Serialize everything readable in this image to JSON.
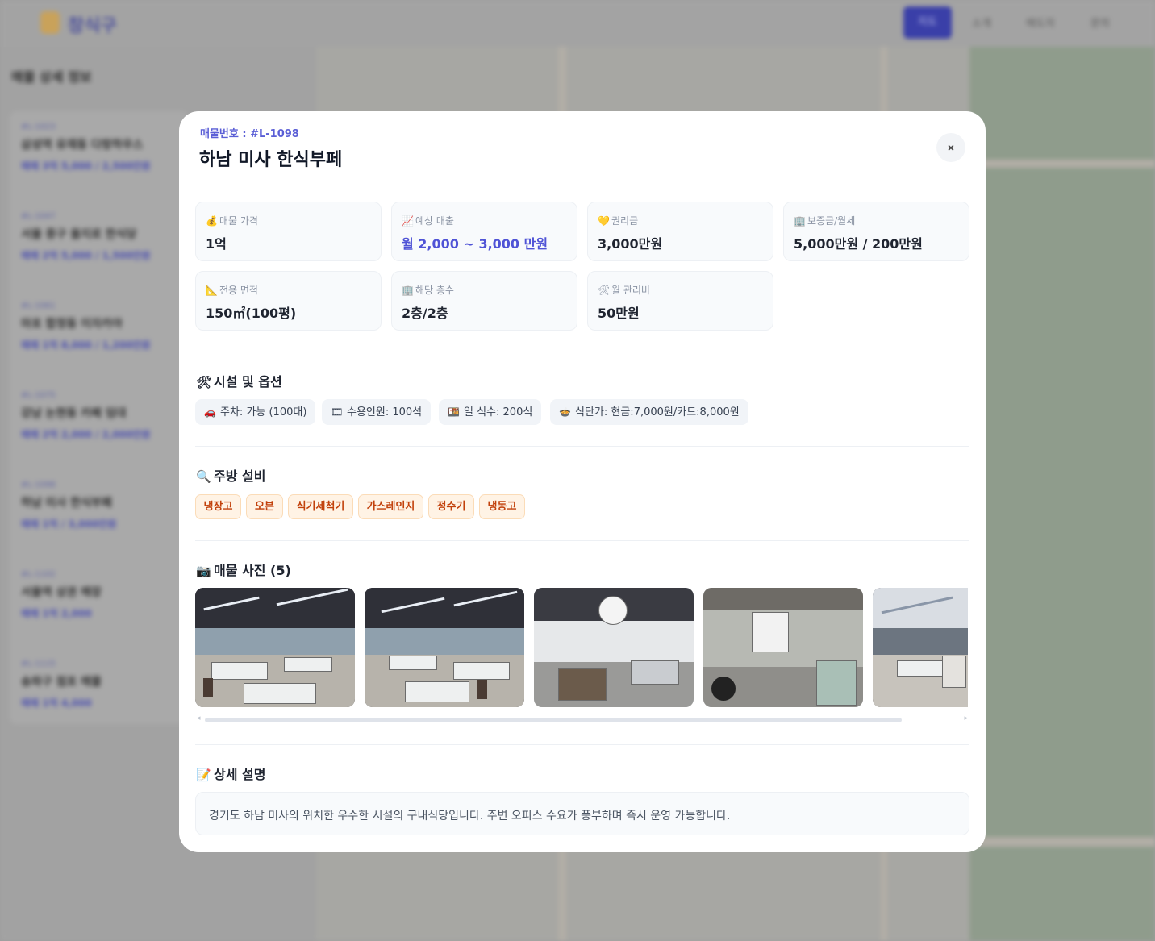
{
  "background": {
    "logo_text": "창식구",
    "nav": [
      "지도",
      "소개",
      "매도자",
      "문의"
    ],
    "sidebar_title": "매물 상세 정보",
    "sidebar_items": [
      {
        "id": "#L-1023",
        "name": "삼성역 유재동 다랑하우스",
        "price": "매매 3억 5,000 / 2,500만원"
      },
      {
        "id": "#L-1047",
        "name": "서울 중구 을지로 한식당",
        "price": "매매 2억 5,000 / 1,500만원"
      },
      {
        "id": "#L-1061",
        "name": "마포 합정동 이자카야",
        "price": "매매 1억 8,000 / 1,200만원"
      },
      {
        "id": "#L-1075",
        "name": "강남 논현동 카페 임대",
        "price": "매매 2억 2,000 / 2,000만원"
      },
      {
        "id": "#L-1098",
        "name": "하남 미사 한식부페",
        "price": "매매 1억 / 3,000만원"
      },
      {
        "id": "#L-1102",
        "name": "서울역 상권 매장",
        "price": "매매 1억 2,000"
      },
      {
        "id": "#L-1115",
        "name": "송파구 점포 매물",
        "price": "매매 1억 4,000"
      }
    ]
  },
  "modal": {
    "listing_no": "매물번호 : #L-1098",
    "title": "하남 미사 한식부페",
    "close_label": "×",
    "info": [
      {
        "icon": "💰",
        "label": "매물 가격",
        "value": "1억",
        "accent": false
      },
      {
        "icon": "📈",
        "label": "예상 매출",
        "value": "월 2,000 ~ 3,000 만원",
        "accent": true
      },
      {
        "icon": "💛",
        "label": "권리금",
        "value": "3,000만원",
        "accent": false
      },
      {
        "icon": "🏢",
        "label": "보증금/월세",
        "value": "5,000만원 / 200만원",
        "accent": false
      },
      {
        "icon": "📐",
        "label": "전용 면적",
        "value": "150㎡(100평)",
        "accent": false
      },
      {
        "icon": "🏢",
        "label": "해당 층수",
        "value": "2층/2층",
        "accent": false
      },
      {
        "icon": "🛠",
        "label": "월 관리비",
        "value": "50만원",
        "accent": false
      }
    ],
    "facilities": {
      "title": "시설 및 옵션",
      "icon": "🛠",
      "chips": [
        {
          "icon": "🚗",
          "text": "주차: 가능 (100대)"
        },
        {
          "icon": "🎞",
          "text": "수용인원: 100석"
        },
        {
          "icon": "🍱",
          "text": "일 식수: 200식"
        },
        {
          "icon": "🍲",
          "text": "식단가: 현금:7,000원/카드:8,000원"
        }
      ]
    },
    "kitchen": {
      "title": "주방 설비",
      "icon": "🔍",
      "tags": [
        "냉장고",
        "오븐",
        "식기세척기",
        "가스레인지",
        "정수기",
        "냉동고"
      ]
    },
    "photos": {
      "title": "매물 사진 (5)",
      "icon": "📷",
      "count": 5
    },
    "description": {
      "title": "상세 설명",
      "icon": "📝",
      "text": "경기도 하남 미사의 위치한 우수한 시설의 구내식당입니다. 주변 오피스 수요가 풍부하며 즉시 운영 가능합니다."
    }
  }
}
